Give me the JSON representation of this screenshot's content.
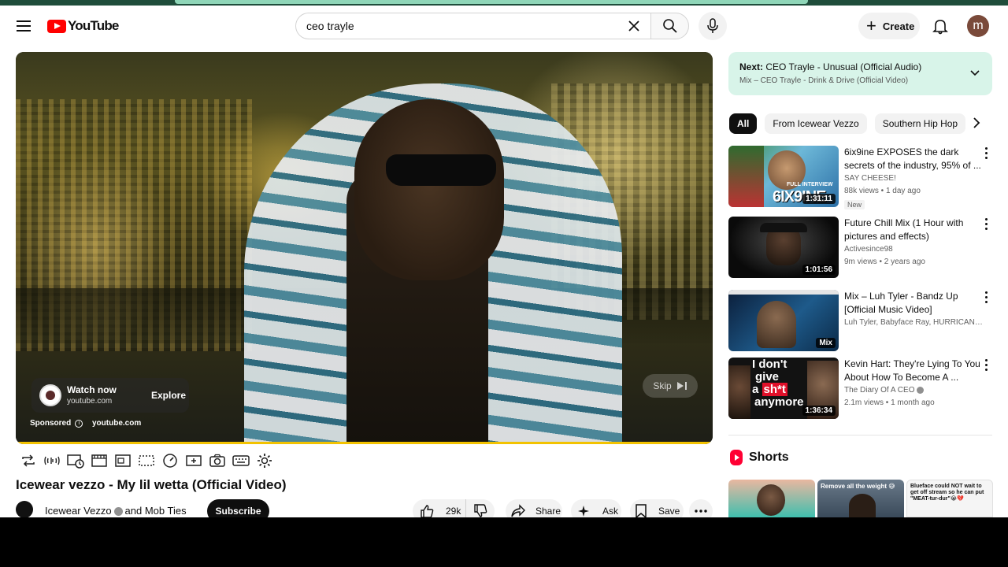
{
  "header": {
    "logo_text": "YouTube",
    "search_value": "ceo trayle",
    "create_label": "Create",
    "avatar_letter": "m"
  },
  "player": {
    "ad_title": "Watch now",
    "ad_domain": "youtube.com",
    "ad_explore": "Explore",
    "ad_sponsored": "Sponsored",
    "ad_site": "youtube.com",
    "skip_label": "Skip",
    "progress_fraction": 0.999
  },
  "video": {
    "title": "Icewear vezzo - My lil wetta (Official Video)",
    "channel": "Icewear Vezzo",
    "channel_suffix": "and Mob Ties",
    "subscribe_label": "Subscribe",
    "likes": "29k",
    "share_label": "Share",
    "ask_label": "Ask",
    "save_label": "Save"
  },
  "next": {
    "prefix": "Next:",
    "title": "CEO Trayle - Unusual (Official Audio)",
    "playlist": "Mix – CEO Trayle - Drink & Drive (Official Video)"
  },
  "chips": [
    "All",
    "From Icewear Vezzo",
    "Southern Hip Hop"
  ],
  "recommendations": [
    {
      "title": "6ix9ine EXPOSES the dark secrets of the industry, 95% of ...",
      "channel": "SAY CHEESE!",
      "meta": "88k views • 1 day ago",
      "badge": "New",
      "duration": "1:31:11",
      "thumb_text": "6IX9INE",
      "thumb_sub": "FULL INTERVIEW"
    },
    {
      "title": "Future Chill Mix (1 Hour with pictures and effects)",
      "channel": "Activesince98",
      "meta": "9m views • 2 years ago",
      "duration": "1:01:56"
    },
    {
      "title": "Mix – Luh Tyler - Bandz Up [Official Music Video]",
      "channel": "Luh Tyler, Babyface Ray, HURRICANE WISDOM, and more",
      "meta": "",
      "duration": "Mix"
    },
    {
      "title": "Kevin Hart: They're Lying To You About How To Become A ...",
      "channel": "The Diary Of A CEO",
      "meta": "2.1m views • 1 month ago",
      "duration": "1:36:34",
      "thumb_line1": "I don't",
      "thumb_line2": "give",
      "thumb_line3a": "a ",
      "thumb_line3b": "sh*t",
      "thumb_line4": "anymore"
    }
  ],
  "shorts": {
    "heading": "Shorts",
    "items": [
      {
        "caption": ""
      },
      {
        "caption": "Remove all the weight 😅"
      },
      {
        "caption": "Blueface could NOT wait to get off stream so he can put \"MEAT-tur-dur\"😭💔"
      }
    ]
  },
  "colors": {
    "brand_red": "#ff0000",
    "next_card_bg": "#d8f4e9",
    "progress": "#f2c200"
  }
}
